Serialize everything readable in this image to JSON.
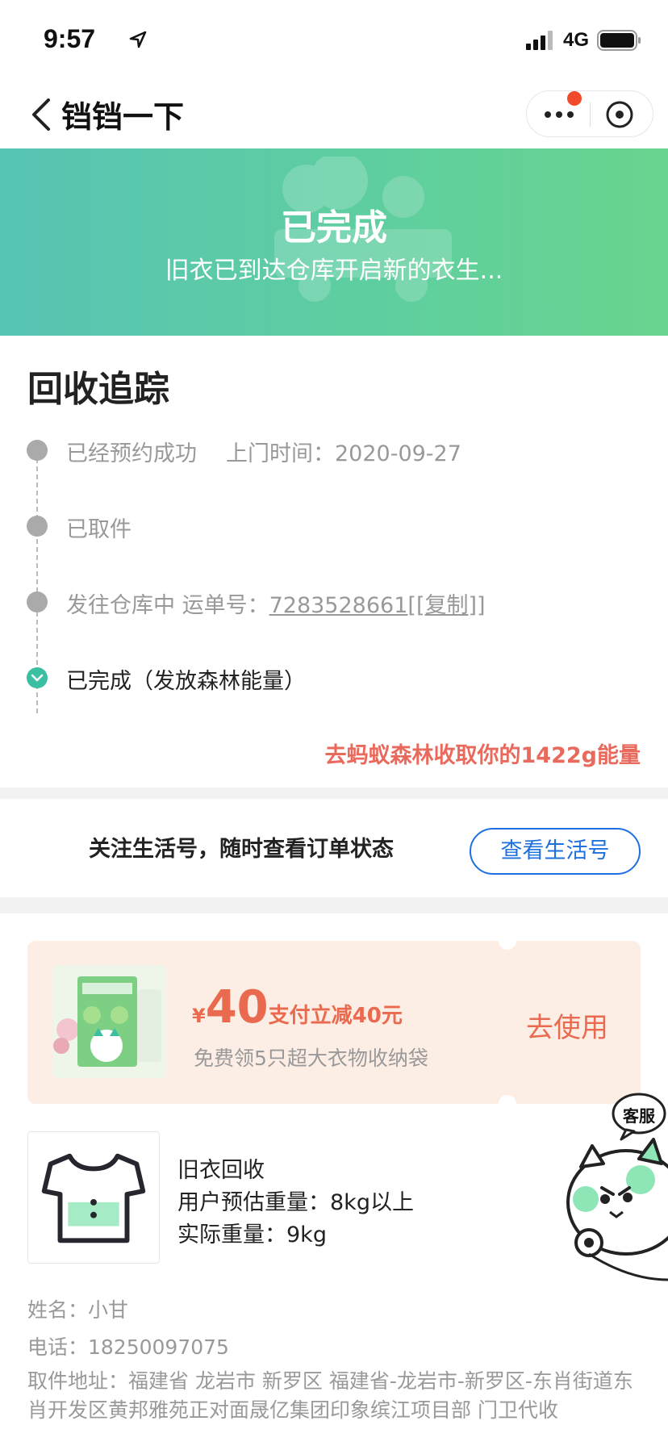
{
  "status_bar": {
    "time": "9:57",
    "network": "4G",
    "icons": [
      "location-arrow-icon",
      "signal-icon",
      "battery-icon"
    ]
  },
  "nav": {
    "title": "铛铛一下",
    "icons": [
      "back-icon",
      "more-icon",
      "close-icon"
    ]
  },
  "banner": {
    "title": "已完成",
    "subtitle": "旧衣已到达仓库开启新的衣生..."
  },
  "tracking": {
    "title": "回收追踪",
    "steps": [
      {
        "label": "已经预约成功",
        "detail": "上门时间：2020-09-27"
      },
      {
        "label": "已取件"
      },
      {
        "label": "发往仓库中 运单号：",
        "waybill": "7283528661",
        "copy": "[复制]"
      },
      {
        "label": "已完成（发放森林能量）"
      }
    ],
    "energy_link": "去蚂蚁森林收取你的1422g能量"
  },
  "follow": {
    "text": "关注生活号，随时查看订单状态",
    "button": "查看生活号"
  },
  "coupon": {
    "symbol": "¥",
    "amount": "40",
    "amount_desc": "支付立减40元",
    "desc": "免费领5只超大衣物收纳袋",
    "action": "去使用"
  },
  "product": {
    "name": "旧衣回收",
    "estimated_weight": "用户预估重量：8kg以上",
    "actual_weight": "实际重量：9kg"
  },
  "service": {
    "label": "客服"
  },
  "info": {
    "name": "姓名：小甘",
    "phone": "电话：18250097075",
    "address": "取件地址：福建省 龙岩市 新罗区 福建省-龙岩市-新罗区-东肖街道东肖开发区黄邦雅苑正对面晟亿集团印象缤江项目部 门卫代收"
  },
  "colors": {
    "banner_start": "#58c4b4",
    "banner_end": "#69d48e",
    "accent_red": "#e96a5c",
    "link_blue": "#1e6fe0",
    "coupon_bg": "#fdeee5",
    "done_teal": "#3bbfa3"
  }
}
